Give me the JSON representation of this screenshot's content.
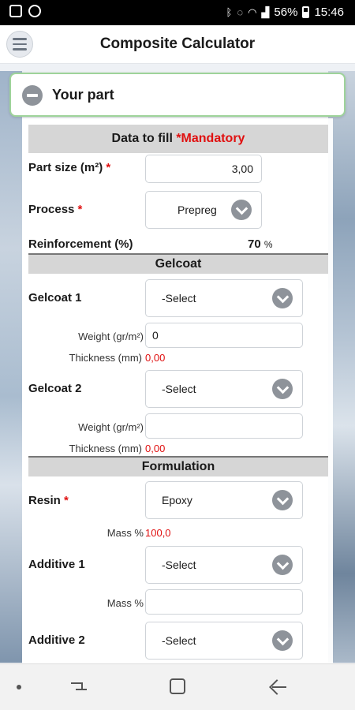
{
  "status_bar": {
    "battery": "56%",
    "time": "15:46"
  },
  "header": {
    "title": "Composite Calculator"
  },
  "section": {
    "title": "Your part"
  },
  "form": {
    "band_main": {
      "label": "Data to fill ",
      "mandatory": "*Mandatory"
    },
    "part_size": {
      "label": "Part size (m²)",
      "star": "*",
      "value": "3,00"
    },
    "process": {
      "label": "Process",
      "star": "*",
      "value": "Prepreg"
    },
    "reinforcement": {
      "label": "Reinforcement (%)",
      "value": "70",
      "unit": "%"
    },
    "gelcoat_band": "Gelcoat",
    "gelcoat1": {
      "label": "Gelcoat 1",
      "select": "-Select",
      "weight_label": "Weight (gr/m²)",
      "weight_value": "0",
      "thickness_label": "Thickness (mm)",
      "thickness_value": "0,00"
    },
    "gelcoat2": {
      "label": "Gelcoat 2",
      "select": "-Select",
      "weight_label": "Weight (gr/m²)",
      "weight_value": "",
      "thickness_label": "Thickness (mm)",
      "thickness_value": "0,00"
    },
    "formulation_band": "Formulation",
    "resin": {
      "label": "Resin",
      "star": "*",
      "select": "Epoxy",
      "mass_label": "Mass %",
      "mass_value": "100,0"
    },
    "additive1": {
      "label": "Additive 1",
      "select": "-Select",
      "mass_label": "Mass %",
      "mass_value": ""
    },
    "additive2": {
      "label": "Additive 2",
      "select": "-Select"
    }
  },
  "colors": {
    "accent_green": "#9ed39a",
    "mandatory_red": "#e01010",
    "band_gray": "#d6d6d6"
  },
  "icons": {
    "menu": "hamburger-icon",
    "collapse": "minus-circle-icon",
    "dropdown": "chevron-down-icon"
  }
}
